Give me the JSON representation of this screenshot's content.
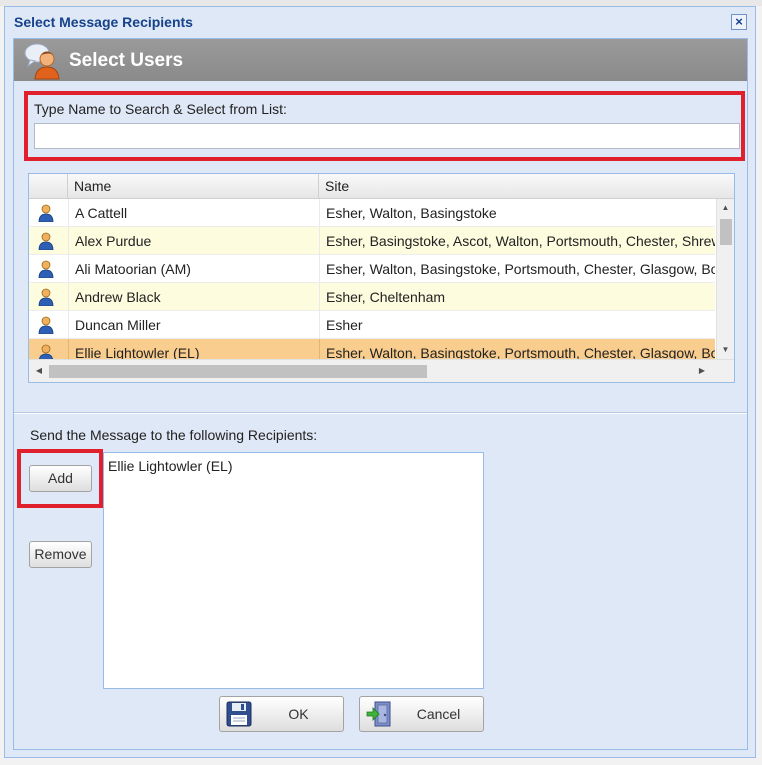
{
  "dialog": {
    "title": "Select Message Recipients",
    "close_symbol": "×",
    "banner_title": "Select Users",
    "banner_icon": "user-chat-icon"
  },
  "search": {
    "label": "Type Name to Search & Select from List:",
    "value": "",
    "placeholder": ""
  },
  "grid": {
    "columns": [
      "Name",
      "Site"
    ],
    "rows": [
      {
        "name": "A Cattell",
        "site": "Esher, Walton, Basingstoke",
        "state": "normal"
      },
      {
        "name": "Alex Purdue",
        "site": "Esher, Basingstoke, Ascot, Walton, Portsmouth, Chester, Shrewsbury",
        "state": "alt"
      },
      {
        "name": "Ali Matoorian (AM)",
        "site": "Esher, Walton, Basingstoke, Portsmouth, Chester, Glasgow, Bournemouth",
        "state": "normal"
      },
      {
        "name": "Andrew Black",
        "site": "Esher, Cheltenham",
        "state": "alt"
      },
      {
        "name": "Duncan Miller",
        "site": "Esher",
        "state": "normal"
      },
      {
        "name": "Ellie Lightowler (EL)",
        "site": "Esher, Walton, Basingstoke, Portsmouth, Chester, Glasgow, Bournemouth",
        "state": "selected"
      }
    ],
    "row_icon": "user-icon"
  },
  "recipients": {
    "label": "Send the Message to the following Recipients:",
    "items": [
      "Ellie Lightowler (EL)"
    ]
  },
  "buttons": {
    "add": "Add",
    "remove": "Remove",
    "ok": "OK",
    "cancel": "Cancel"
  },
  "colors": {
    "highlight_border": "#e0212d",
    "selected_row": "#f9cd8d",
    "alt_row": "#fdfcde",
    "title_text": "#15428b",
    "banner_bg": "#8f8f8f"
  }
}
